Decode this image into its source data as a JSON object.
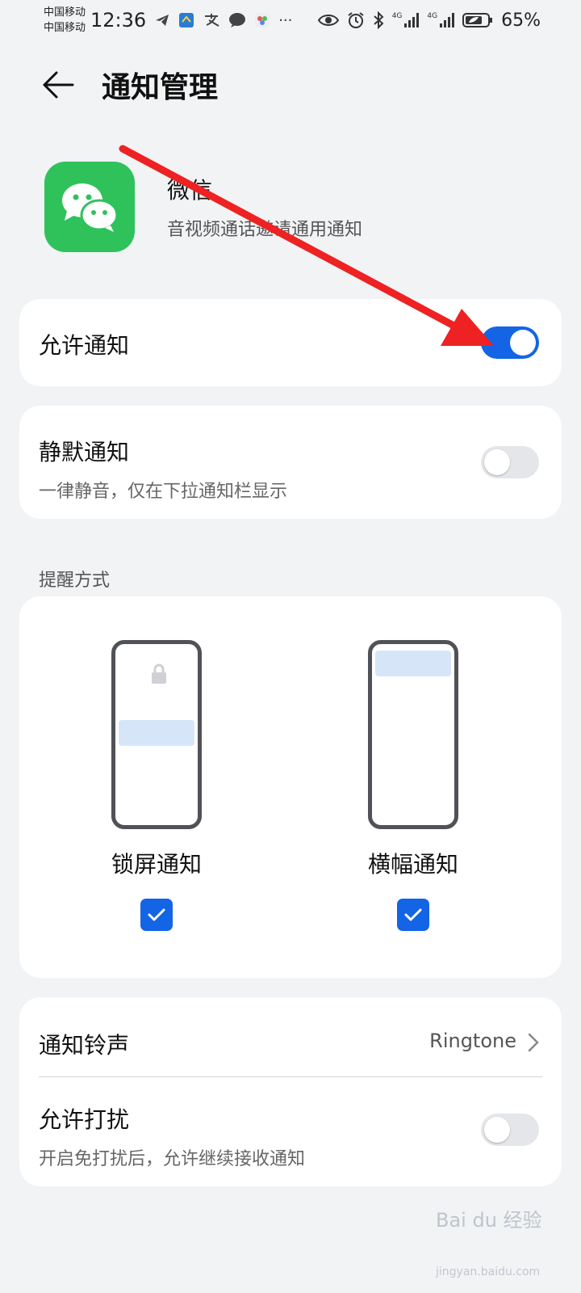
{
  "status_bar": {
    "carrier_1": "中国移动",
    "carrier_2": "中国移动",
    "time": "12:36",
    "more": "···",
    "network_1": "4G",
    "network_2": "4G",
    "battery": "65%",
    "icons": [
      "telegram-icon",
      "app-icon",
      "zhifubao-icon",
      "message-icon",
      "app-store-icon",
      "eye-icon",
      "alarm-icon",
      "bluetooth-icon",
      "signal-icon",
      "battery-icon"
    ]
  },
  "header": {
    "title": "通知管理"
  },
  "app": {
    "name": "微信",
    "subtitle": "音视频通话邀请通用通知",
    "icon_color": "#2fc25b"
  },
  "allow_notifications": {
    "label": "允许通知",
    "enabled": true
  },
  "silent_notifications": {
    "label": "静默通知",
    "description": "一律静音，仅在下拉通知栏显示",
    "enabled": false
  },
  "reminder": {
    "section_label": "提醒方式",
    "options": [
      {
        "label": "锁屏通知",
        "checked": true
      },
      {
        "label": "横幅通知",
        "checked": true
      }
    ]
  },
  "ringtone": {
    "label": "通知铃声",
    "value": "Ringtone"
  },
  "dnd": {
    "label": "允许打扰",
    "description": "开启免打扰后，允许继续接收通知",
    "enabled": false
  },
  "watermark": {
    "text": "Bai du 经验",
    "sub": "jingyan.baidu.com"
  },
  "colors": {
    "accent": "#1464e6",
    "annotation_arrow": "#ee2222",
    "background": "#f1f3f5"
  }
}
